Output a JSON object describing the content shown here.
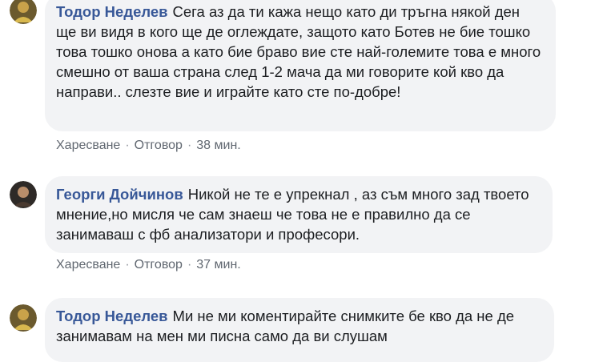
{
  "comments": [
    {
      "author": "Тодор Неделев",
      "text": "Сега аз да ти кажа нещо като ди тръгна някой ден ще ви видя в кого ще де оглеждате, защото като Ботев не бие тошко това тошко онова а като бие браво вие сте най-големите това е много смешно от ваша страна след 1-2 мача да ми говорите кой кво да направи.. слезте вие и играйте като сте по-добре!",
      "like_label": "Харесване",
      "reply_label": "Отговор",
      "time": "38 мин."
    },
    {
      "author": "Георги Дойчинов",
      "text": "Никой не те е упрекнал , аз съм много зад твоето мнение,но мисля че сам знаеш че това не е правилно да се занимаваш с фб анализатори и професори.",
      "like_label": "Харесване",
      "reply_label": "Отговор",
      "time": "37 мин."
    },
    {
      "author": "Тодор Неделев",
      "text": "Ми не ми коментирайте снимките бе кво да не де занимавам на мен ми писна само да ви слушам"
    }
  ],
  "colors": {
    "author": "#385898",
    "bubble": "#f2f3f5",
    "meta": "#606770"
  },
  "icons": {
    "avatar_1": "avatar-photo-icon",
    "avatar_2": "avatar-photo-icon",
    "avatar_3": "avatar-photo-icon"
  }
}
